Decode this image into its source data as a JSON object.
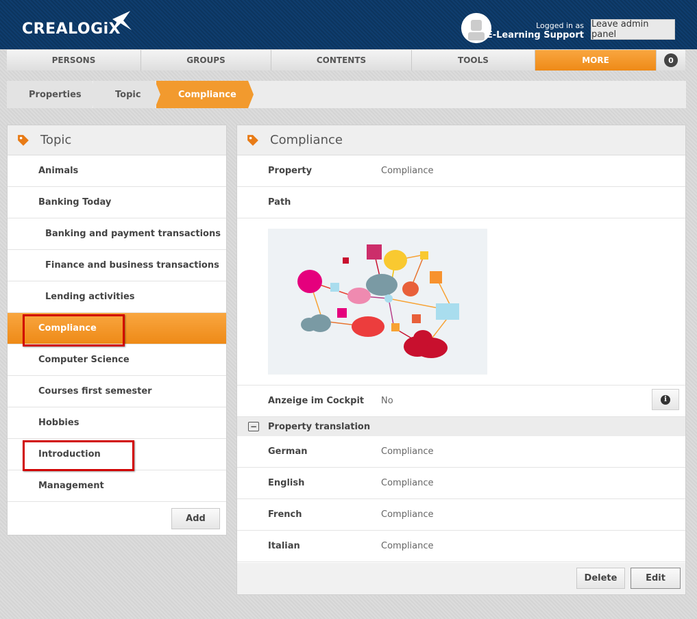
{
  "brand": {
    "name": "CREALOGiX",
    "accent": "#f29a2e",
    "header_bg": "#0e3a68"
  },
  "header": {
    "logged_in_label": "Logged in as",
    "user_name": "E-Learning Support",
    "leave_button": "Leave admin panel"
  },
  "nav": {
    "items": [
      {
        "label": "PERSONS"
      },
      {
        "label": "GROUPS"
      },
      {
        "label": "CONTENTS"
      },
      {
        "label": "TOOLS"
      },
      {
        "label": "MORE",
        "active": true
      }
    ],
    "count": "0"
  },
  "breadcrumb": [
    {
      "label": "Properties",
      "icon": "tag-icon"
    },
    {
      "label": "Topic",
      "icon": "tag-icon"
    },
    {
      "label": "Compliance",
      "icon": "tag-icon",
      "active": true
    }
  ],
  "left_panel": {
    "title": "Topic",
    "items": [
      {
        "label": "Animals"
      },
      {
        "label": "Banking Today"
      },
      {
        "label": "Banking and payment transactions",
        "sub": true
      },
      {
        "label": "Finance and business transactions",
        "sub": true
      },
      {
        "label": "Lending activities",
        "sub": true
      },
      {
        "label": "Compliance",
        "active": true
      },
      {
        "label": "Computer Science"
      },
      {
        "label": "Courses first semester"
      },
      {
        "label": "Hobbies"
      },
      {
        "label": "Introduction"
      },
      {
        "label": "Management"
      }
    ],
    "add_button": "Add"
  },
  "right_panel": {
    "title": "Compliance",
    "property_label": "Property",
    "property_value": "Compliance",
    "path_label": "Path",
    "cockpit_label": "Anzeige im Cockpit",
    "cockpit_value": "No",
    "translation_header": "Property translation",
    "translations": [
      {
        "lang": "German",
        "value": "Compliance"
      },
      {
        "lang": "English",
        "value": "Compliance"
      },
      {
        "lang": "French",
        "value": "Compliance"
      },
      {
        "lang": "Italian",
        "value": "Compliance"
      }
    ],
    "delete_button": "Delete",
    "edit_button": "Edit"
  }
}
